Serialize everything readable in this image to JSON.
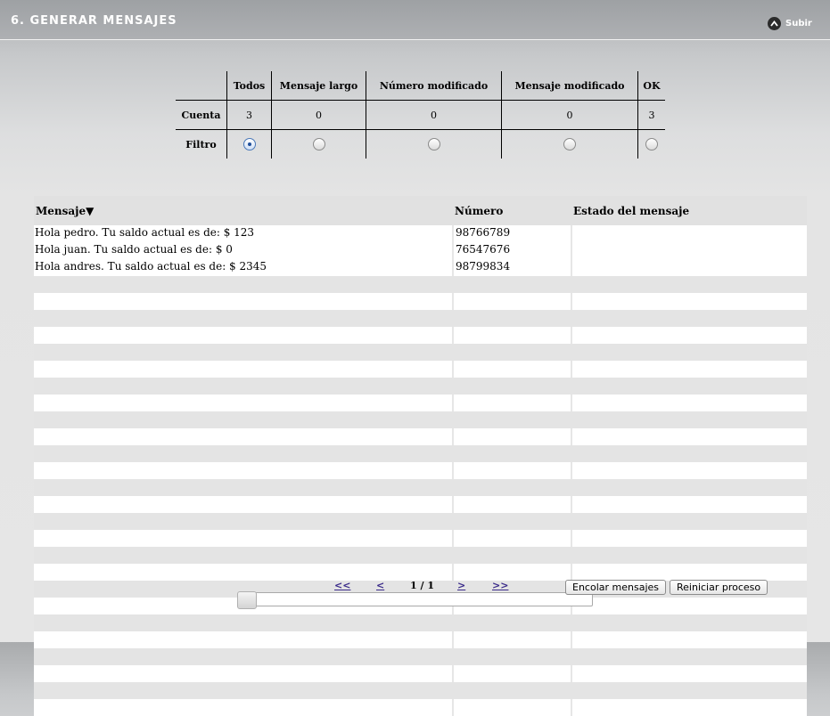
{
  "header": {
    "title": "6. GENERAR MENSAJES",
    "subir_label": "Subir"
  },
  "summary": {
    "columns": [
      "Todos",
      "Mensaje largo",
      "Número modificado",
      "Mensaje modificado",
      "OK"
    ],
    "count_label": "Cuenta",
    "counts": [
      "3",
      "0",
      "0",
      "0",
      "3"
    ],
    "filter_label": "Filtro",
    "selected_filter": "Todos"
  },
  "messages": {
    "headers": {
      "mensaje": "Mensaje",
      "sort_indicator": "▼",
      "numero": "Número",
      "estado": "Estado del mensaje"
    },
    "rows": [
      {
        "mensaje": "Hola pedro. Tu saldo actual es de: $ 123",
        "numero": "98766789",
        "estado": ""
      },
      {
        "mensaje": "Hola juan. Tu saldo actual es de: $ 0",
        "numero": "76547676",
        "estado": ""
      },
      {
        "mensaje": "Hola andres. Tu saldo actual es de: $ 2345",
        "numero": "98799834",
        "estado": ""
      }
    ]
  },
  "pager": {
    "first": "<<",
    "prev": "<",
    "page_info": "1 / 1",
    "next": ">",
    "last": ">>"
  },
  "buttons": {
    "enqueue": "Encolar mensajes",
    "restart": "Reiniciar proceso"
  },
  "icons": {
    "subir": "chevron-up-icon",
    "sort": "sort-desc-icon"
  }
}
